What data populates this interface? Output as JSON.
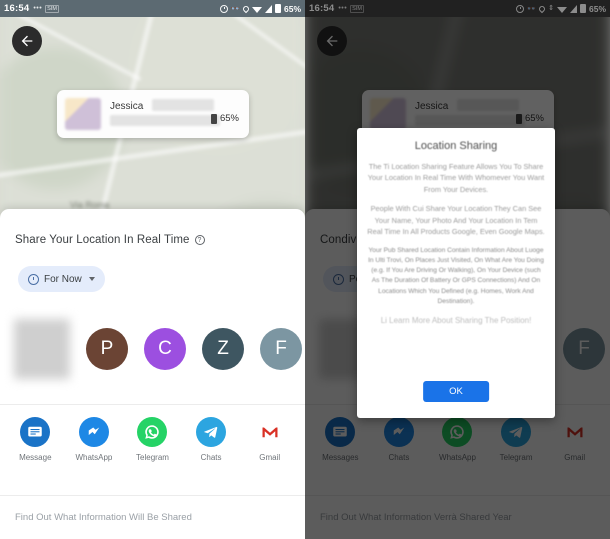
{
  "left": {
    "statusbar": {
      "time": "16:54",
      "dots": "•••",
      "sim": "SIM",
      "battery_percent": "65%",
      "icons": [
        "alarm-icon",
        "glasses-icon",
        "location-pin-icon",
        "wifi-icon",
        "signal-icon",
        "battery-icon"
      ]
    },
    "back_button": "back-arrow",
    "info_card": {
      "name": "Jessica",
      "battery": "65%"
    },
    "sheet": {
      "title": "Share Your Location In Real Time",
      "help_icon": "?",
      "chip": {
        "label": "For Now",
        "icon": "clock-icon",
        "caret": "chevron-down-icon"
      },
      "avatars": [
        {
          "letter": "",
          "color": "#cfcfcf",
          "blurred": true
        },
        {
          "letter": "P",
          "color": "#6b4434",
          "blurred": false
        },
        {
          "letter": "C",
          "color": "#9c4fe0",
          "blurred": false
        },
        {
          "letter": "Z",
          "color": "#3e5661",
          "blurred": false
        },
        {
          "letter": "F",
          "color": "#7c96a2",
          "blurred": false
        }
      ],
      "apps": [
        {
          "label": "Message",
          "icon": "messages-icon"
        },
        {
          "label": "WhatsApp",
          "icon": "messenger-icon"
        },
        {
          "label": "Telegram",
          "icon": "whatsapp-icon"
        },
        {
          "label": "Chats",
          "icon": "telegram-icon"
        },
        {
          "label": "Gmail",
          "icon": "gmail-icon"
        }
      ],
      "footer": "Find Out What Information Will Be Shared"
    }
  },
  "right": {
    "statusbar": {
      "time": "16:54",
      "dots": "•••",
      "sim": "SIM",
      "battery_percent": "65%",
      "icons": [
        "alarm-icon",
        "glasses-icon",
        "location-pin-icon",
        "arrows-icon",
        "wifi-icon",
        "signal-icon",
        "battery-icon"
      ]
    },
    "back_button": "back-arrow",
    "info_card": {
      "name": "Jessica",
      "battery": "65%"
    },
    "sheet": {
      "title": "Condividi",
      "chip": {
        "label": "Per",
        "icon": "clock-icon",
        "caret": "chevron-down-icon"
      },
      "avatars": [
        {
          "letter": "",
          "color": "#cfcfcf",
          "blurred": true
        },
        {
          "letter": "F",
          "color": "#7c96a2",
          "blurred": false
        }
      ],
      "apps": [
        {
          "label": "Messages",
          "icon": "messages-icon"
        },
        {
          "label": "Chats",
          "icon": "messenger-icon"
        },
        {
          "label": "WhatsApp",
          "icon": "whatsapp-icon"
        },
        {
          "label": "Telegram",
          "icon": "telegram-icon"
        },
        {
          "label": "Gmail",
          "icon": "gmail-icon"
        }
      ],
      "footer": "Find Out What Information Verrà Shared Year"
    },
    "dialog": {
      "title": "Location Sharing",
      "paragraph1": "The Ti Location Sharing Feature Allows You To Share Your Location In Real Time With Whomever You Want From Your Devices.",
      "paragraph2": "People With Cui Share Your Location They Can See Your Name, Your Photo And Your Location In Tem Real Time In All Products Google, Even Google Maps.",
      "paragraph3": "Your Pub Shared Location Contain Information About Luoge In Ulti Trovi, On Places Just Visited, On What Are You Doing (e.g. If You Are Driving Or Walking), On Your Device (such As The Duration Of Battery Or GPS Connections) And On Locations Which You Defined (e.g. Homes, Work And Destination).",
      "link": "Li Learn More About Sharing The Position!",
      "ok_button": "OK"
    }
  },
  "colors": {
    "accent": "#1a73e8",
    "chip_bg": "#e4ecfb",
    "statusbar_left": "#5c6a72",
    "statusbar_right": "#3c3c3c"
  }
}
